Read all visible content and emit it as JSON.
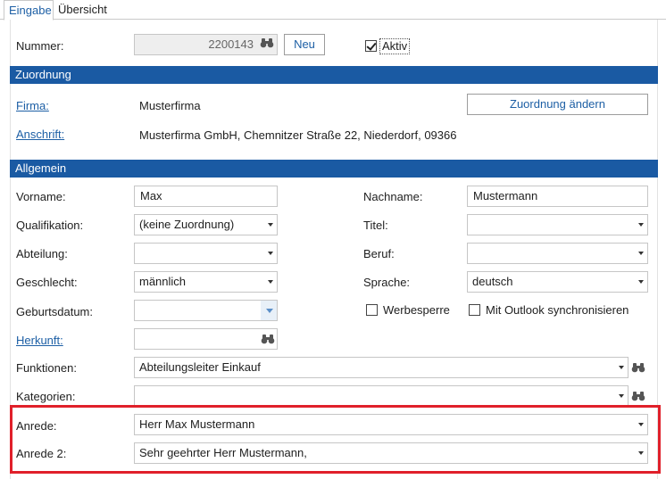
{
  "tabs": {
    "eingabe": "Eingabe",
    "uebersicht": "Übersicht"
  },
  "header": {
    "nummer_label": "Nummer:",
    "nummer_value": "2200143",
    "neu_button": "Neu",
    "aktiv_label": "Aktiv",
    "aktiv_checked": true
  },
  "zuordnung": {
    "title": "Zuordnung",
    "firma_label": "Firma:",
    "firma_value": "Musterfirma",
    "anschrift_label": "Anschrift:",
    "anschrift_value": "Musterfirma GmbH, Chemnitzer Straße 22, Niederdorf, 09366",
    "change_button": "Zuordnung ändern"
  },
  "allgemein": {
    "title": "Allgemein",
    "vorname_label": "Vorname:",
    "vorname_value": "Max",
    "nachname_label": "Nachname:",
    "nachname_value": "Mustermann",
    "qualifikation_label": "Qualifikation:",
    "qualifikation_value": "(keine Zuordnung)",
    "titel_label": "Titel:",
    "titel_value": "",
    "abteilung_label": "Abteilung:",
    "abteilung_value": "",
    "beruf_label": "Beruf:",
    "beruf_value": "",
    "geschlecht_label": "Geschlecht:",
    "geschlecht_value": "männlich",
    "sprache_label": "Sprache:",
    "sprache_value": "deutsch",
    "geburtsdatum_label": "Geburtsdatum:",
    "geburtsdatum_value": "",
    "werbesperre_label": "Werbesperre",
    "outlook_label": "Mit Outlook synchronisieren",
    "herkunft_label": "Herkunft:",
    "herkunft_value": "",
    "funktionen_label": "Funktionen:",
    "funktionen_value": "Abteilungsleiter Einkauf",
    "kategorien_label": "Kategorien:",
    "kategorien_value": "",
    "anrede_label": "Anrede:",
    "anrede_value": "Herr Max Mustermann",
    "anrede2_label": "Anrede 2:",
    "anrede2_value": "Sehr geehrter Herr Mustermann,"
  },
  "colors": {
    "accent": "#1a5aa3",
    "link": "#1d5fa5",
    "highlight": "#e0202a"
  },
  "icons": {
    "lookup": "binoculars-icon",
    "dropdown": "chevron-down-icon"
  }
}
